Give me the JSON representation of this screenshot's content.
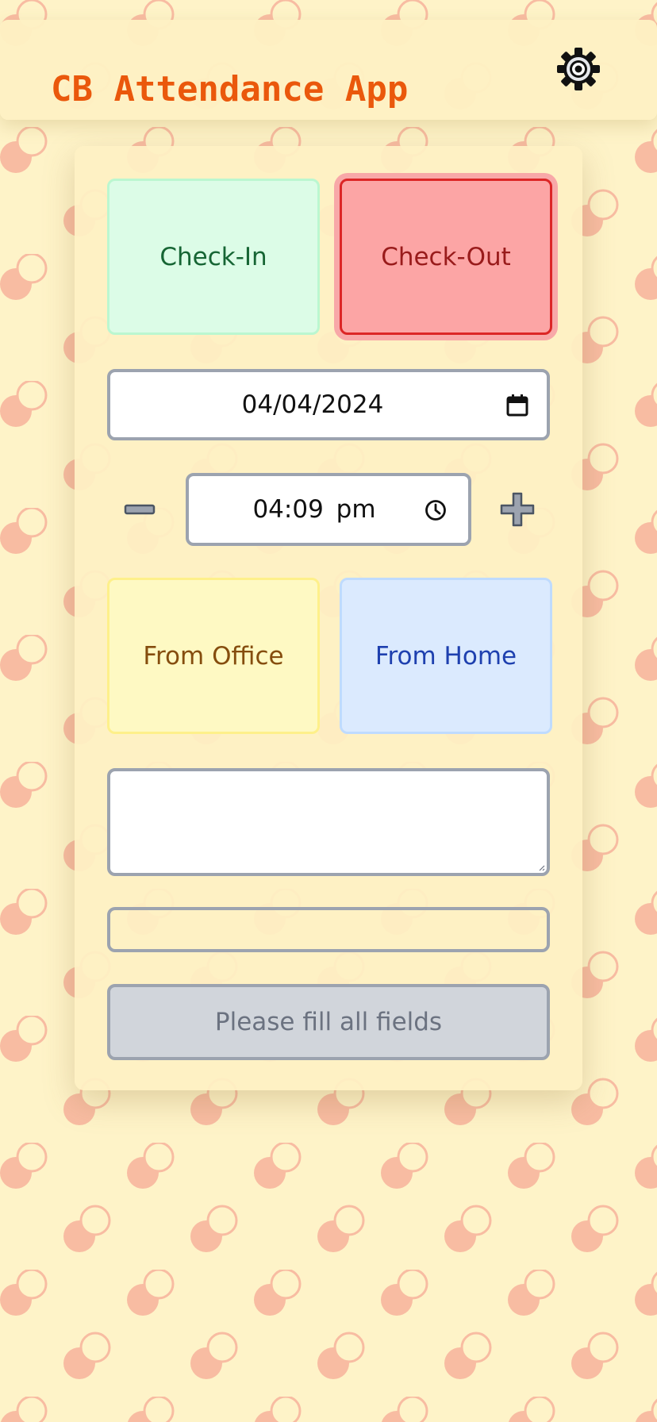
{
  "header": {
    "title": "CB Attendance App",
    "settings_icon": "gear-icon"
  },
  "attendance": {
    "checkin_label": "Check-In",
    "checkout_label": "Check-Out",
    "selected_type": "Check-Out"
  },
  "date": {
    "value": "04/04/2024",
    "icon": "calendar-icon"
  },
  "time": {
    "value": "04:09 pm",
    "icon": "clock-icon",
    "decrement_icon": "minus-icon",
    "increment_icon": "plus-icon"
  },
  "location": {
    "office_label": "From Office",
    "home_label": "From Home"
  },
  "notes": {
    "value": ""
  },
  "status": {
    "value": ""
  },
  "submit": {
    "label": "Please fill all fields",
    "disabled": true
  },
  "colors": {
    "background": "#fef3c8",
    "pattern": "#f8bca2",
    "title": "#ea580c",
    "checkin_bg": "#dcfce7",
    "checkout_bg": "#fca5a5",
    "checkout_border": "#dc2626",
    "office_bg": "#fef9c3",
    "home_bg": "#dbeafe",
    "field_border": "#9ca3af",
    "button_disabled_bg": "#d1d5db"
  }
}
